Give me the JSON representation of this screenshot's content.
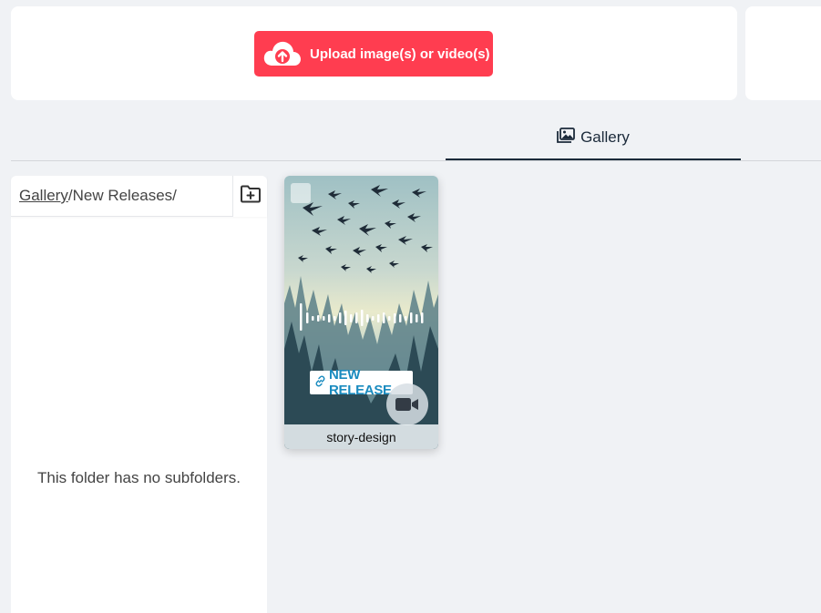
{
  "upload": {
    "button_label": "Upload image(s) or video(s)",
    "icon": "cloud-upload-icon"
  },
  "tabs": [
    {
      "label": "Gallery",
      "icon": "image-icon",
      "active": true
    }
  ],
  "folder_panel": {
    "breadcrumb_root": "Gallery",
    "breadcrumb_rest": "/New Releases/",
    "new_folder_icon": "folder-plus-icon",
    "empty_message": "This folder has no subfolders."
  },
  "media": [
    {
      "name": "story-design",
      "badge_text": "NEW RELEASE",
      "badge_icon": "link-icon",
      "type_icon": "video-camera-icon"
    }
  ],
  "colors": {
    "accent": "#ff3d50",
    "tab_active": "#1b2a3a",
    "badge_text": "#1a8bbf",
    "background": "#f0f2f5"
  }
}
